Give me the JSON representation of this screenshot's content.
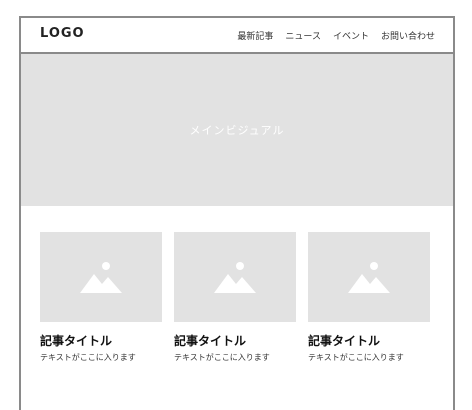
{
  "header": {
    "logo": "LOGO",
    "nav": [
      "最新記事",
      "ニュース",
      "イベント",
      "お問い合わせ"
    ]
  },
  "hero": {
    "label": "メインビジュアル"
  },
  "cards": [
    {
      "title": "記事タイトル",
      "text": "テキストがここに入ります",
      "icon": "image-placeholder-icon"
    },
    {
      "title": "記事タイトル",
      "text": "テキストがここに入ります",
      "icon": "image-placeholder-icon"
    },
    {
      "title": "記事タイトル",
      "text": "テキストがここに入ります",
      "icon": "image-placeholder-icon"
    }
  ],
  "colors": {
    "border": "#8a8a8a",
    "placeholder": "#e2e2e2",
    "text": "#222222"
  }
}
